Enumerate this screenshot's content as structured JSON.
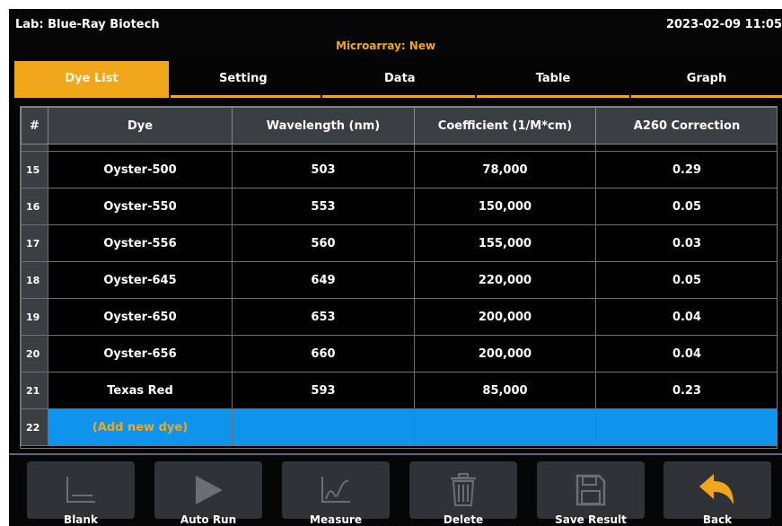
{
  "header": {
    "lab": "Lab: Blue-Ray Biotech",
    "mode": "Microarray: New",
    "datetime": "2023-02-09 11:05"
  },
  "tabs": [
    {
      "label": "Dye List",
      "active": true
    },
    {
      "label": "Setting",
      "active": false
    },
    {
      "label": "Data",
      "active": false
    },
    {
      "label": "Table",
      "active": false
    },
    {
      "label": "Graph",
      "active": false
    }
  ],
  "table": {
    "columns": [
      "#",
      "Dye",
      "Wavelength (nm)",
      "Coefficient (1/M*cm)",
      "A260 Correction"
    ],
    "rows": [
      {
        "num": "15",
        "dye": "Oyster-500",
        "wavelength": "503",
        "coefficient": "78,000",
        "a260": "0.29"
      },
      {
        "num": "16",
        "dye": "Oyster-550",
        "wavelength": "553",
        "coefficient": "150,000",
        "a260": "0.05"
      },
      {
        "num": "17",
        "dye": "Oyster-556",
        "wavelength": "560",
        "coefficient": "155,000",
        "a260": "0.03"
      },
      {
        "num": "18",
        "dye": "Oyster-645",
        "wavelength": "649",
        "coefficient": "220,000",
        "a260": "0.05"
      },
      {
        "num": "19",
        "dye": "Oyster-650",
        "wavelength": "653",
        "coefficient": "200,000",
        "a260": "0.04"
      },
      {
        "num": "20",
        "dye": "Oyster-656",
        "wavelength": "660",
        "coefficient": "200,000",
        "a260": "0.04"
      },
      {
        "num": "21",
        "dye": "Texas Red",
        "wavelength": "593",
        "coefficient": "85,000",
        "a260": "0.23"
      }
    ],
    "add_row": {
      "num": "22",
      "label": "(Add new dye)"
    }
  },
  "toolbar": [
    {
      "label": "Blank",
      "icon": "blank-baseline-icon"
    },
    {
      "label": "Auto Run",
      "icon": "play-icon"
    },
    {
      "label": "Measure",
      "icon": "measure-curve-icon"
    },
    {
      "label": "Delete",
      "icon": "trash-icon"
    },
    {
      "label": "Save Result",
      "icon": "floppy-disk-icon"
    },
    {
      "label": "Back",
      "icon": "back-arrow-icon"
    }
  ],
  "colors": {
    "accent": "#f0a71c",
    "selection": "#0e94ec",
    "header_bg": "#3b3e43",
    "button_bg": "#2f3338",
    "disabled_icon": "#6b6f74"
  }
}
